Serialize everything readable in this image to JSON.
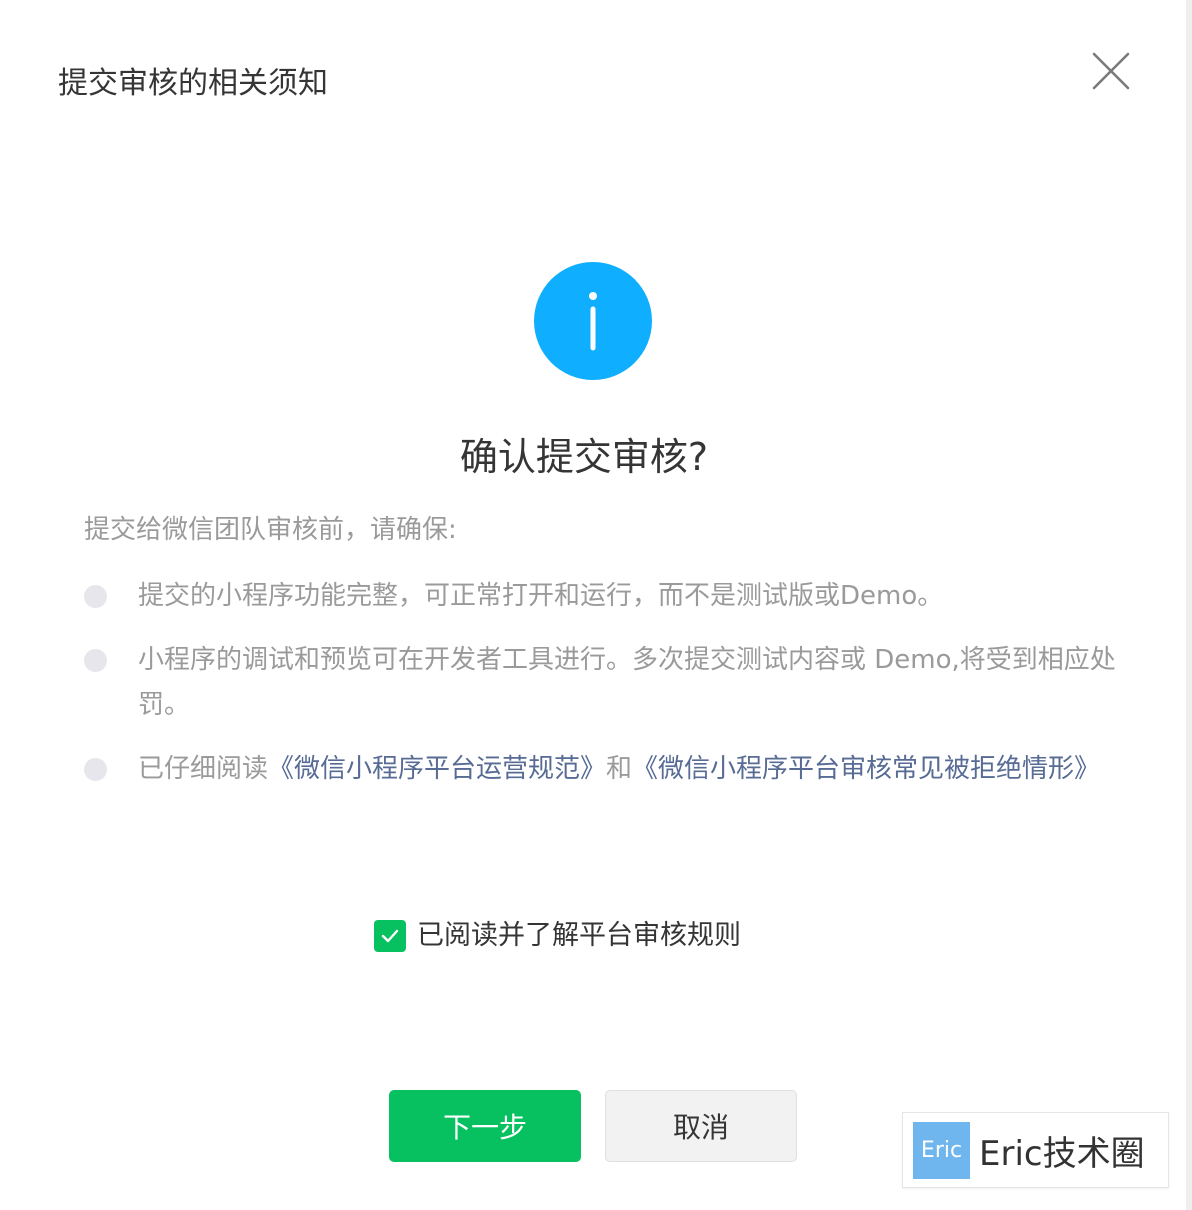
{
  "dialog": {
    "title": "提交审核的相关须知",
    "close_icon": "close-icon",
    "info_icon": "info-icon",
    "heading": "确认提交审核?",
    "intro": "提交给微信团队审核前，请确保:",
    "rules": [
      {
        "text": "提交的小程序功能完整，可正常打开和运行，而不是测试版或Demo。"
      },
      {
        "text": "小程序的调试和预览可在开发者工具进行。多次提交测试内容或 Demo,将受到相应处罚。"
      },
      {
        "prefix": "已仔细阅读",
        "link1": "《微信小程序平台运营规范》",
        "middle": "和",
        "link2": "《微信小程序平台审核常见被拒绝情形》"
      }
    ],
    "agree": {
      "label": "已阅读并了解平台审核规则",
      "checked": true
    },
    "buttons": {
      "next": "下一步",
      "cancel": "取消"
    }
  },
  "watermark": {
    "logo_text": "Eric",
    "text": "Eric技术圈"
  },
  "colors": {
    "primary_green": "#07c160",
    "info_blue": "#10aeff",
    "link_blue": "#576b95",
    "muted_text": "#9a9a9a",
    "title_text": "#353535"
  }
}
